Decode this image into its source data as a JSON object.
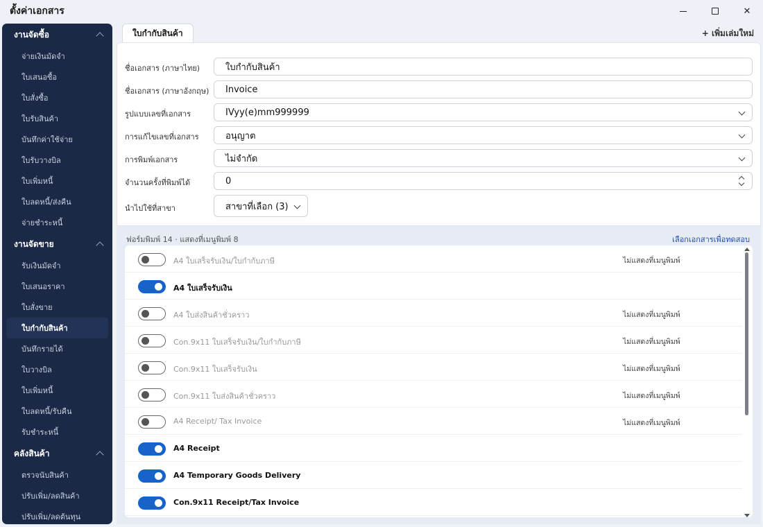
{
  "window": {
    "title": "ตั้งค่าเอกสาร"
  },
  "sidebar": {
    "groups": [
      {
        "title": "งานจัดซื้อ",
        "items": [
          "จ่ายเงินมัดจำ",
          "ใบเสนอซื้อ",
          "ใบสั่งซื้อ",
          "ใบรับสินค้า",
          "บันทึกค่าใช้จ่าย",
          "ใบรับวางบิล",
          "ใบเพิ่มหนี้",
          "ใบลดหนี้/ส่งคืน",
          "จ่ายชำระหนี้"
        ]
      },
      {
        "title": "งานจัดขาย",
        "items": [
          "รับเงินมัดจำ",
          "ใบเสนอราคา",
          "ใบสั่งขาย",
          "ใบกำกับสินค้า",
          "บันทึกรายได้",
          "ใบวางบิล",
          "ใบเพิ่มหนี้",
          "ใบลดหนี้/รับคืน",
          "รับชำระหนี้"
        ]
      },
      {
        "title": "คลังสินค้า",
        "items": [
          "ตรวจนับสินค้า",
          "ปรับเพิ่ม/ลดสินค้า",
          "ปรับเพิ่ม/ลดต้นทุน"
        ]
      }
    ],
    "active": "ใบกำกับสินค้า"
  },
  "tabs": {
    "active_label": "ใบกำกับสินค้า",
    "add_new_label": "+ เพิ่มเล่มใหม่"
  },
  "form": {
    "name_th": {
      "label": "ชื่อเอกสาร (ภาษาไทย)",
      "value": "ใบกำกับสินค้า"
    },
    "name_en": {
      "label": "ชื่อเอกสาร (ภาษาอังกฤษ)",
      "value": "Invoice"
    },
    "numbering": {
      "label": "รูปแบบเลขที่เอกสาร",
      "value": "IVyy(e)mm999999"
    },
    "edit_number": {
      "label": "การแก้ไขเลขที่เอกสาร",
      "value": "อนุญาต"
    },
    "printing": {
      "label": "การพิมพ์เอกสาร",
      "value": "ไม่จำกัด"
    },
    "print_count": {
      "label": "จำนวนครั้งที่พิมพ์ได้",
      "value": "0"
    },
    "branches": {
      "label": "นำไปใช้ที่สาขา",
      "value": "สาขาที่เลือก (3)"
    }
  },
  "print_forms": {
    "summary": "ฟอร์มพิมพ์ 14 · แสดงที่เมนูพิมพ์ 8",
    "choose_link": "เลือกเอกสารเพื่อทดสอบ",
    "rows": [
      {
        "name": "A4 ใบเสร็จรับเงิน/ใบกำกับภาษี",
        "on": false,
        "status": "ไม่แสดงที่เมนูพิมพ์"
      },
      {
        "name": "A4 ใบเสร็จรับเงิน",
        "on": true,
        "status": ""
      },
      {
        "name": "A4 ใบส่งสินค้าชั่วคราว",
        "on": false,
        "status": "ไม่แสดงที่เมนูพิมพ์"
      },
      {
        "name": "Con.9x11 ใบเสร็จรับเงิน/ใบกำกับภาษี",
        "on": false,
        "status": "ไม่แสดงที่เมนูพิมพ์"
      },
      {
        "name": "Con.9x11 ใบเสร็จรับเงิน",
        "on": false,
        "status": "ไม่แสดงที่เมนูพิมพ์"
      },
      {
        "name": "Con.9x11 ใบส่งสินค้าชั่วคราว",
        "on": false,
        "status": "ไม่แสดงที่เมนูพิมพ์"
      },
      {
        "name": "A4 Receipt/ Tax Invoice",
        "on": false,
        "status": "ไม่แสดงที่เมนูพิมพ์"
      },
      {
        "name": "A4 Receipt",
        "on": true,
        "status": ""
      },
      {
        "name": "A4 Temporary Goods Delivery",
        "on": true,
        "status": ""
      },
      {
        "name": "Con.9x11 Receipt/Tax Invoice",
        "on": true,
        "status": ""
      }
    ]
  }
}
